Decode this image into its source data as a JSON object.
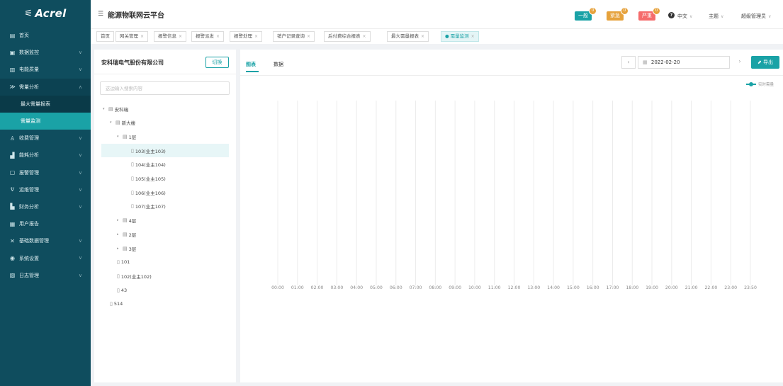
{
  "sidebar": {
    "logo": "Acrel",
    "items": [
      {
        "name": "home",
        "icon": "home-icon",
        "glyph": "▤",
        "label": "首页",
        "chevron": false
      },
      {
        "name": "data-monitor",
        "icon": "monitor-icon",
        "glyph": "▣",
        "label": "数据监控",
        "chevron": true
      },
      {
        "name": "power-quality",
        "icon": "power-quality-icon",
        "glyph": "▥",
        "label": "电能质量",
        "chevron": true
      },
      {
        "name": "demand-analysis",
        "icon": "demand-icon",
        "glyph": "≫",
        "label": "需量分析",
        "chevron": true,
        "open": true
      },
      {
        "name": "max-demand-report",
        "sub": true,
        "first": true,
        "label": "最大需量报表"
      },
      {
        "name": "demand-monitor",
        "sub": true,
        "active": true,
        "label": "需量监测"
      },
      {
        "name": "billing",
        "icon": "billing-icon",
        "glyph": "♙",
        "label": "收费管理",
        "chevron": true
      },
      {
        "name": "energy-analysis",
        "icon": "energy-icon",
        "glyph": "▟",
        "label": "能耗分析",
        "chevron": true
      },
      {
        "name": "alarm",
        "icon": "alarm-icon",
        "glyph": "▢",
        "label": "报警管理",
        "chevron": true
      },
      {
        "name": "maintenance",
        "icon": "maintenance-icon",
        "glyph": "ᕓ",
        "label": "运维管理",
        "chevron": true
      },
      {
        "name": "finance",
        "icon": "finance-icon",
        "glyph": "▙",
        "label": "财务分析",
        "chevron": true
      },
      {
        "name": "user-report",
        "icon": "report-icon",
        "glyph": "▦",
        "label": "用户报告",
        "chevron": false
      },
      {
        "name": "base-data",
        "icon": "base-data-icon",
        "glyph": "✕",
        "label": "基础数据管理",
        "chevron": true
      },
      {
        "name": "system-settings",
        "icon": "settings-icon",
        "glyph": "◉",
        "label": "系统设置",
        "chevron": true
      },
      {
        "name": "log",
        "icon": "log-icon",
        "glyph": "▧",
        "label": "日志管理",
        "chevron": true
      }
    ]
  },
  "header": {
    "title": "能源物联网云平台",
    "alerts": [
      {
        "label": "一般",
        "count": "0",
        "color": "#1aa2a6"
      },
      {
        "label": "紧急",
        "count": "0",
        "color": "#e6a23c"
      },
      {
        "label": "严重",
        "count": "0",
        "color": "#f56c6c"
      }
    ],
    "language": "中文",
    "theme": "主题",
    "user": "超级管理员"
  },
  "tabs": [
    {
      "label": "首页",
      "closable": false
    },
    {
      "label": "网关管理",
      "closable": true
    },
    {
      "label": "报警信息",
      "closable": true
    },
    {
      "label": "报警派发",
      "closable": true
    },
    {
      "label": "报警处理",
      "closable": true
    },
    {
      "label": "销户记录查询",
      "closable": true
    },
    {
      "label": "后付费综合报表",
      "closable": true
    },
    {
      "label": "最大需量报表",
      "closable": true
    },
    {
      "label": "需量监测",
      "closable": true,
      "active": true
    }
  ],
  "left": {
    "company": "安科瑞电气股份有限公司",
    "switch_label": "切换",
    "search_placeholder": "这边输入搜索内容",
    "tree": [
      {
        "label": "安科瑞",
        "level": 0,
        "expander": "▾",
        "icon": "▤"
      },
      {
        "label": "新大楼",
        "level": 1,
        "expander": "▾",
        "icon": "▤"
      },
      {
        "label": "1层",
        "level": 2,
        "expander": "▾",
        "icon": "▤"
      },
      {
        "label": "103(业主103)",
        "level": 3,
        "expander": "",
        "icon": "▯",
        "selected": true
      },
      {
        "label": "104(业主104)",
        "level": 3,
        "expander": "",
        "icon": "▯"
      },
      {
        "label": "105(业主105)",
        "level": 3,
        "expander": "",
        "icon": "▯"
      },
      {
        "label": "106(业主106)",
        "level": 3,
        "expander": "",
        "icon": "▯"
      },
      {
        "label": "107(业主107)",
        "level": 3,
        "expander": "",
        "icon": "▯"
      },
      {
        "label": "4层",
        "level": 2,
        "expander": "▸",
        "icon": "▤"
      },
      {
        "label": "2层",
        "level": 2,
        "expander": "▸",
        "icon": "▤"
      },
      {
        "label": "3层",
        "level": 2,
        "expander": "▸",
        "icon": "▤"
      },
      {
        "label": "101",
        "level": 1,
        "expander": "",
        "icon": "▯"
      },
      {
        "label": "102(业主102)",
        "level": 1,
        "expander": "",
        "icon": "▯"
      },
      {
        "label": "43",
        "level": 1,
        "expander": "",
        "icon": "▯"
      },
      {
        "label": "514",
        "level": 0,
        "expander": "",
        "icon": "▯"
      }
    ]
  },
  "right": {
    "tab_chart": "图表",
    "tab_data": "数据",
    "date": "2022-02-20",
    "export_label": "导出"
  },
  "chart_data": {
    "type": "line",
    "title": "",
    "x": [
      "00:00",
      "01:00",
      "02:00",
      "03:00",
      "04:00",
      "05:00",
      "06:00",
      "07:00",
      "08:00",
      "09:00",
      "10:00",
      "11:00",
      "12:00",
      "13:00",
      "14:00",
      "15:00",
      "16:00",
      "17:00",
      "18:00",
      "19:00",
      "20:00",
      "21:00",
      "22:00",
      "23:00",
      "23:50"
    ],
    "series": [
      {
        "name": "实时需量",
        "values": [],
        "color": "#1aa2a6"
      }
    ],
    "grid": "vertical",
    "legend": "top-right"
  }
}
